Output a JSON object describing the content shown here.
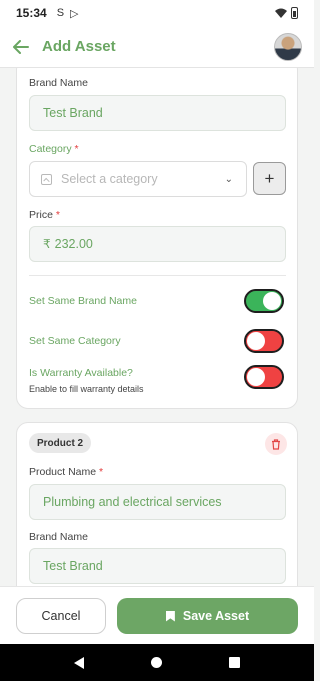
{
  "status_bar": {
    "time": "15:34",
    "icons": [
      "sim-icon",
      "play-store-icon",
      "wifi-icon",
      "battery-icon"
    ]
  },
  "app_bar": {
    "title": "Add Asset"
  },
  "product1": {
    "brand_label": "Brand Name",
    "brand_value": "Test Brand",
    "category_label": "Category",
    "category_placeholder": "Select a category",
    "price_label": "Price",
    "price_symbol": "₹",
    "price_value": "232.00",
    "required_mark": "*",
    "set_same_brand_label": "Set Same Brand Name",
    "set_same_brand_on": true,
    "set_same_category_label": "Set Same Category",
    "set_same_category_on": false,
    "warranty_label": "Is Warranty Available?",
    "warranty_sub": "Enable to fill warranty details",
    "warranty_on": false
  },
  "product2": {
    "badge": "Product 2",
    "name_label": "Product Name",
    "name_value": "Plumbing and electrical services",
    "brand_label": "Brand Name",
    "brand_value": "Test Brand"
  },
  "actions": {
    "cancel": "Cancel",
    "save": "Save Asset"
  },
  "colors": {
    "accent": "#6aa662",
    "toggle_on": "#3bb45a",
    "toggle_off": "#ef4242",
    "required": "#e23b3b"
  }
}
